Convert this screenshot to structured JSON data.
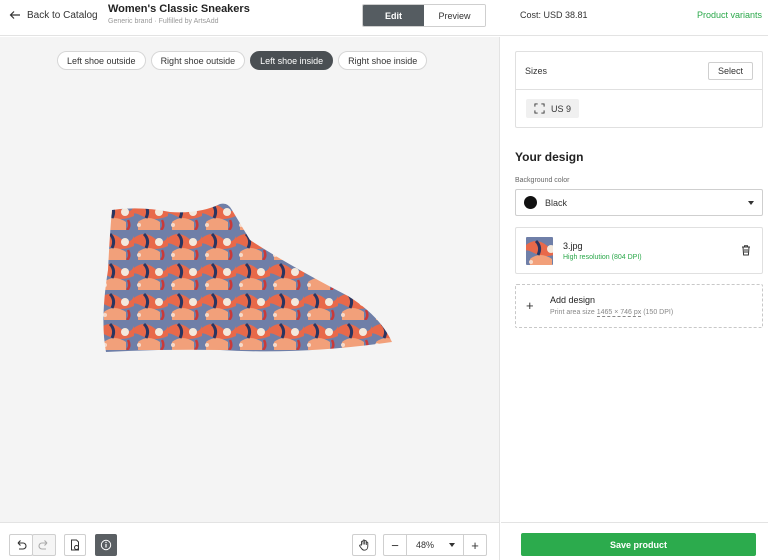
{
  "header": {
    "back_label": "Back to Catalog",
    "product_title": "Women's Classic Sneakers",
    "product_subtitle": "Generic brand · Fulfilled by ArtsAdd",
    "edit_label": "Edit",
    "preview_label": "Preview",
    "cost": "Cost: USD 38.81",
    "variants_link": "Product variants"
  },
  "view_tabs": [
    {
      "label": "Left shoe outside",
      "active": false
    },
    {
      "label": "Right shoe outside",
      "active": false
    },
    {
      "label": "Left shoe inside",
      "active": true
    },
    {
      "label": "Right shoe inside",
      "active": false
    }
  ],
  "toolbar": {
    "zoom_value": "48%",
    "zoom_minus": "−",
    "zoom_plus": "+"
  },
  "sizes": {
    "title": "Sizes",
    "select_label": "Select",
    "selected_size": "US 9"
  },
  "design": {
    "heading": "Your design",
    "background_label": "Background color",
    "background_value": "Black",
    "background_hex": "#111111",
    "file_name": "3.jpg",
    "file_resolution": "High resolution (804 DPI)",
    "add_title": "Add design",
    "add_sub_prefix": "Print area size ",
    "add_sub_size": "1465 × 746 px",
    "add_sub_dpi": " (150 DPI)"
  },
  "save_label": "Save product",
  "colors": {
    "accent_green": "#2cab4d",
    "active_tab": "#4a4f53"
  }
}
